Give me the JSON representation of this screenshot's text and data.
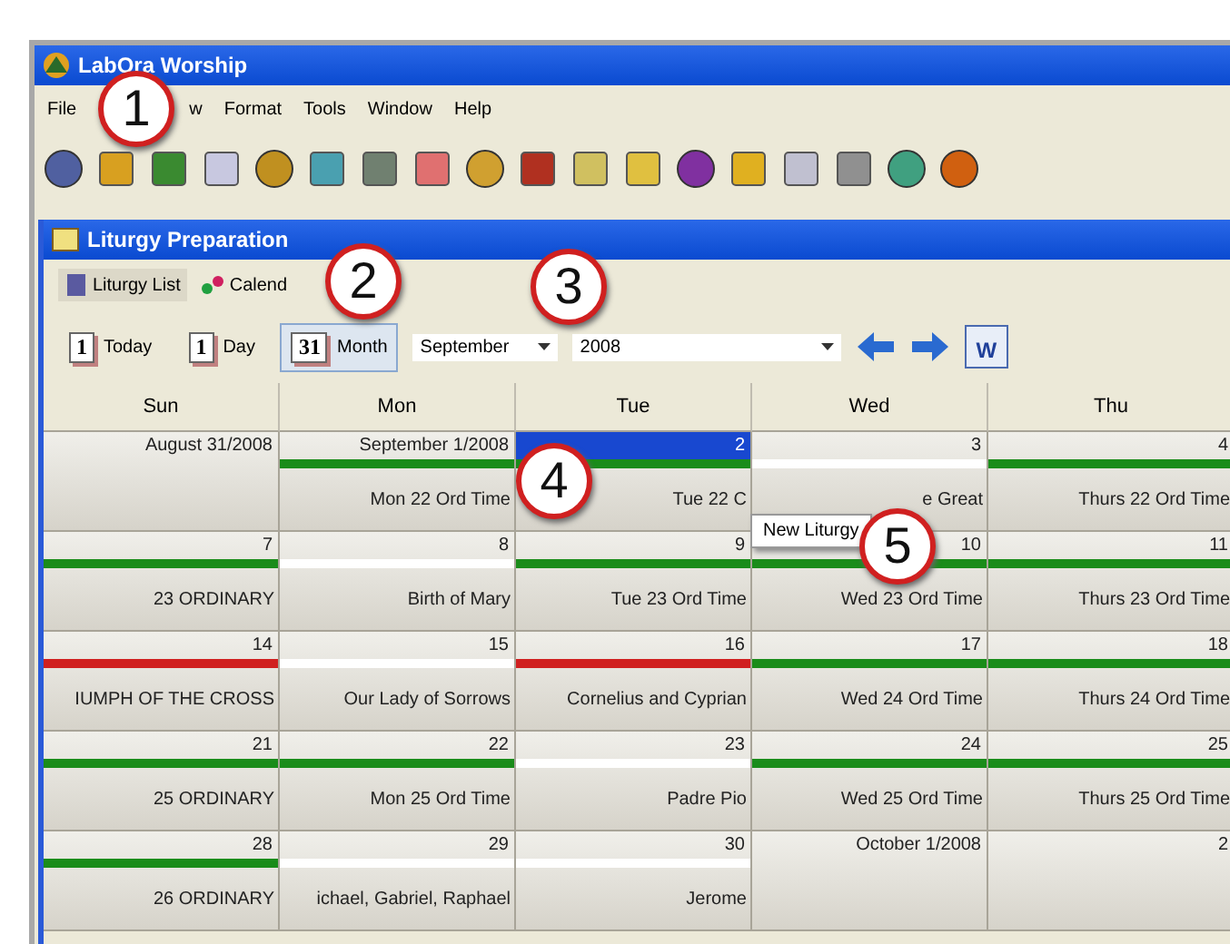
{
  "window": {
    "title": "LabOra Worship"
  },
  "menu": [
    "File",
    "w",
    "Format",
    "Tools",
    "Window",
    "Help"
  ],
  "child_window": {
    "title": "Liturgy Preparation"
  },
  "tabs": [
    {
      "label": "Liturgy List",
      "selected": true
    },
    {
      "label": "Calend",
      "selected": false
    }
  ],
  "view_buttons": [
    {
      "icon_text": "1",
      "label": "Today",
      "selected": false
    },
    {
      "icon_text": "1",
      "label": "Day",
      "selected": false
    },
    {
      "icon_text": "31",
      "label": "Month",
      "selected": true
    }
  ],
  "month_select": {
    "value": "September"
  },
  "year_select": {
    "value": "2008"
  },
  "export_icon_text": "W",
  "columns": [
    "Sun",
    "Mon",
    "Tue",
    "Wed",
    "Thu"
  ],
  "weeks": [
    [
      {
        "date": "August 31/2008",
        "selected": false
      },
      {
        "date": "September 1/2008",
        "title": "Mon 22 Ord Time",
        "color": "#1a8c1a",
        "selected": false
      },
      {
        "date": "2",
        "title": "Tue 22 C",
        "color": "#1a8c1a",
        "selected": true
      },
      {
        "date": "3",
        "title": "e Great",
        "color": "#ffffff",
        "selected": false
      },
      {
        "date": "4",
        "title": "Thurs 22 Ord Time",
        "color": "#1a8c1a",
        "selected": false
      }
    ],
    [
      {
        "date": "7",
        "title": "23 ORDINARY",
        "color": "#1a8c1a",
        "selected": false
      },
      {
        "date": "8",
        "title": "Birth of Mary",
        "color": "#ffffff",
        "selected": false
      },
      {
        "date": "9",
        "title": "Tue 23 Ord Time",
        "color": "#1a8c1a",
        "selected": false
      },
      {
        "date": "10",
        "title": "Wed 23 Ord Time",
        "color": "#1a8c1a",
        "selected": false
      },
      {
        "date": "11",
        "title": "Thurs 23 Ord Time",
        "color": "#1a8c1a",
        "selected": false
      }
    ],
    [
      {
        "date": "14",
        "title": "IUMPH OF THE CROSS",
        "color": "#d02020",
        "selected": false
      },
      {
        "date": "15",
        "title": "Our Lady of Sorrows",
        "color": "#ffffff",
        "selected": false
      },
      {
        "date": "16",
        "title": "Cornelius and Cyprian",
        "color": "#d02020",
        "selected": false
      },
      {
        "date": "17",
        "title": "Wed 24 Ord Time",
        "color": "#1a8c1a",
        "selected": false
      },
      {
        "date": "18",
        "title": "Thurs 24 Ord Time",
        "color": "#1a8c1a",
        "selected": false
      }
    ],
    [
      {
        "date": "21",
        "title": "25 ORDINARY",
        "color": "#1a8c1a",
        "selected": false
      },
      {
        "date": "22",
        "title": "Mon 25 Ord Time",
        "color": "#1a8c1a",
        "selected": false
      },
      {
        "date": "23",
        "title": "Padre Pio",
        "color": "#ffffff",
        "selected": false
      },
      {
        "date": "24",
        "title": "Wed 25 Ord Time",
        "color": "#1a8c1a",
        "selected": false
      },
      {
        "date": "25",
        "title": "Thurs 25 Ord Time",
        "color": "#1a8c1a",
        "selected": false
      }
    ],
    [
      {
        "date": "28",
        "title": "26 ORDINARY",
        "color": "#1a8c1a",
        "selected": false
      },
      {
        "date": "29",
        "title": "ichael, Gabriel, Raphael",
        "color": "#ffffff",
        "selected": false
      },
      {
        "date": "30",
        "title": "Jerome",
        "color": "#ffffff",
        "selected": false
      },
      {
        "date": "October 1/2008",
        "selected": false
      },
      {
        "date": "2",
        "selected": false
      }
    ]
  ],
  "context_menu": [
    "New Liturgy"
  ],
  "callouts": [
    "1",
    "2",
    "3",
    "4",
    "5"
  ]
}
